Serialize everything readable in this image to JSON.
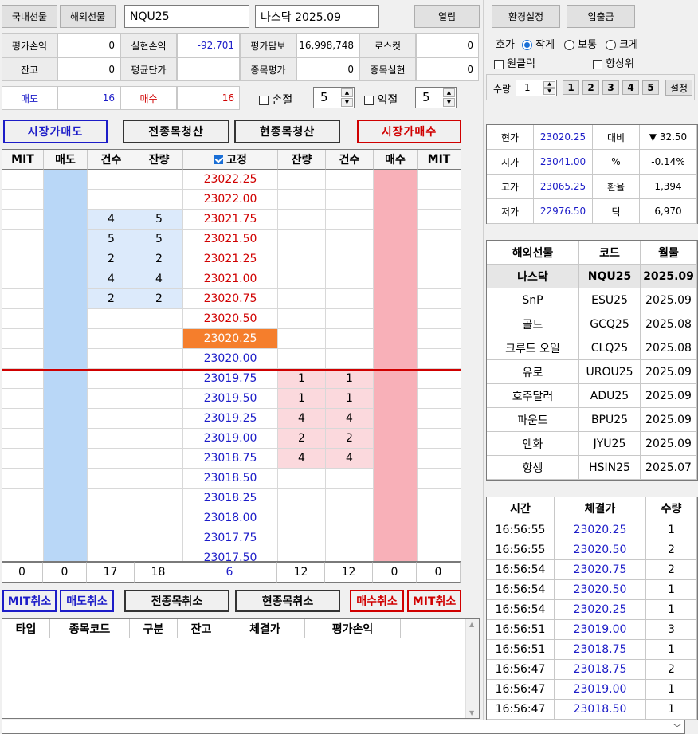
{
  "top": {
    "domestic_btn": "국내선물",
    "overseas_btn": "해외선물",
    "code": "NQU25",
    "name": "나스닥 2025.09",
    "open_btn": "열림",
    "settings_btn": "환경설정",
    "deposit_btn": "입출금"
  },
  "info": {
    "row1": [
      {
        "label": "평가손익",
        "value": "0"
      },
      {
        "label": "실현손익",
        "value": "-92,701"
      },
      {
        "label": "평가담보",
        "value": "16,998,748"
      },
      {
        "label": "로스컷",
        "value": "0"
      }
    ],
    "row2": [
      {
        "label": "잔고",
        "value": "0"
      },
      {
        "label": "평균단가",
        "value": ""
      },
      {
        "label": "종목평가",
        "value": "0"
      },
      {
        "label": "종목실현",
        "value": "0"
      }
    ],
    "sell_label": "매도",
    "sell_value": "16",
    "buy_label": "매수",
    "buy_value": "16",
    "stoploss_label": "손절",
    "stoploss_value": "5",
    "takeprofit_label": "익절",
    "takeprofit_value": "5"
  },
  "actions": {
    "market_sell": "시장가매도",
    "close_all": "전종목청산",
    "close_current": "현종목청산",
    "market_buy": "시장가매수"
  },
  "orderbook": {
    "headers": [
      "MIT",
      "매도",
      "건수",
      "잔량",
      "고정",
      "잔량",
      "건수",
      "매수",
      "MIT"
    ],
    "rows": [
      {
        "price": "23022.25",
        "sc": "",
        "sq": "",
        "bq": "",
        "bc": "",
        "side": "ask"
      },
      {
        "price": "23022.00",
        "sc": "",
        "sq": "",
        "bq": "",
        "bc": "",
        "side": "ask"
      },
      {
        "price": "23021.75",
        "sc": "4",
        "sq": "5",
        "bq": "",
        "bc": "",
        "side": "ask"
      },
      {
        "price": "23021.50",
        "sc": "5",
        "sq": "5",
        "bq": "",
        "bc": "",
        "side": "ask"
      },
      {
        "price": "23021.25",
        "sc": "2",
        "sq": "2",
        "bq": "",
        "bc": "",
        "side": "ask"
      },
      {
        "price": "23021.00",
        "sc": "4",
        "sq": "4",
        "bq": "",
        "bc": "",
        "side": "ask"
      },
      {
        "price": "23020.75",
        "sc": "2",
        "sq": "2",
        "bq": "",
        "bc": "",
        "side": "ask"
      },
      {
        "price": "23020.50",
        "sc": "",
        "sq": "",
        "bq": "",
        "bc": "",
        "side": "ask"
      },
      {
        "price": "23020.25",
        "sc": "",
        "sq": "",
        "bq": "",
        "bc": "",
        "side": "current"
      },
      {
        "price": "23020.00",
        "sc": "",
        "sq": "",
        "bq": "",
        "bc": "",
        "side": "bid"
      },
      {
        "price": "23019.75",
        "sc": "",
        "sq": "",
        "bq": "1",
        "bc": "1",
        "side": "bid"
      },
      {
        "price": "23019.50",
        "sc": "",
        "sq": "",
        "bq": "1",
        "bc": "1",
        "side": "bid"
      },
      {
        "price": "23019.25",
        "sc": "",
        "sq": "",
        "bq": "4",
        "bc": "4",
        "side": "bid"
      },
      {
        "price": "23019.00",
        "sc": "",
        "sq": "",
        "bq": "2",
        "bc": "2",
        "side": "bid"
      },
      {
        "price": "23018.75",
        "sc": "",
        "sq": "",
        "bq": "4",
        "bc": "4",
        "side": "bid"
      },
      {
        "price": "23018.50",
        "sc": "",
        "sq": "",
        "bq": "",
        "bc": "",
        "side": "bid"
      },
      {
        "price": "23018.25",
        "sc": "",
        "sq": "",
        "bq": "",
        "bc": "",
        "side": "bid"
      },
      {
        "price": "23018.00",
        "sc": "",
        "sq": "",
        "bq": "",
        "bc": "",
        "side": "bid"
      },
      {
        "price": "23017.75",
        "sc": "",
        "sq": "",
        "bq": "",
        "bc": "",
        "side": "bid"
      },
      {
        "price": "23017.50",
        "sc": "",
        "sq": "",
        "bq": "",
        "bc": "",
        "side": "bid"
      }
    ],
    "totals": [
      "0",
      "0",
      "17",
      "18",
      "6",
      "12",
      "12",
      "0",
      "0"
    ]
  },
  "cancel": {
    "mit_cancel_left": "MIT취소",
    "sell_cancel": "매도취소",
    "cancel_all": "전종목취소",
    "cancel_current": "현종목취소",
    "buy_cancel": "매수취소",
    "mit_cancel_right": "MIT취소"
  },
  "positions": {
    "headers": [
      "타입",
      "종목코드",
      "구분",
      "잔고",
      "체결가",
      "평가손익"
    ]
  },
  "settings": {
    "hoga_label": "호가",
    "size_small": "작게",
    "size_normal": "보통",
    "size_large": "크게",
    "oneclick": "원클릭",
    "always_top": "항상위",
    "qty_label": "수량",
    "qty_value": "1",
    "qty_presets": [
      "1",
      "2",
      "3",
      "4",
      "5"
    ],
    "set_btn": "설정"
  },
  "quote": {
    "rows": [
      {
        "l1": "현가",
        "v1": "23020.25",
        "l2": "대비",
        "v2": "▼ 32.50"
      },
      {
        "l1": "시가",
        "v1": "23041.00",
        "l2": "%",
        "v2": "-0.14%"
      },
      {
        "l1": "고가",
        "v1": "23065.25",
        "l2": "환율",
        "v2": "1,394"
      },
      {
        "l1": "저가",
        "v1": "22976.50",
        "l2": "틱",
        "v2": "6,970"
      }
    ]
  },
  "futures": {
    "headers": [
      "해외선물",
      "코드",
      "월물"
    ],
    "rows": [
      {
        "name": "나스닥",
        "code": "NQU25",
        "month": "2025.09",
        "selected": true
      },
      {
        "name": "SnP",
        "code": "ESU25",
        "month": "2025.09",
        "selected": false
      },
      {
        "name": "골드",
        "code": "GCQ25",
        "month": "2025.08",
        "selected": false
      },
      {
        "name": "크루드 오일",
        "code": "CLQ25",
        "month": "2025.08",
        "selected": false
      },
      {
        "name": "유로",
        "code": "UROU25",
        "month": "2025.09",
        "selected": false
      },
      {
        "name": "호주달러",
        "code": "ADU25",
        "month": "2025.09",
        "selected": false
      },
      {
        "name": "파운드",
        "code": "BPU25",
        "month": "2025.09",
        "selected": false
      },
      {
        "name": "엔화",
        "code": "JYU25",
        "month": "2025.09",
        "selected": false
      },
      {
        "name": "항셍",
        "code": "HSIN25",
        "month": "2025.07",
        "selected": false
      }
    ]
  },
  "trades": {
    "headers": [
      "시간",
      "체결가",
      "수량"
    ],
    "rows": [
      {
        "time": "16:56:55",
        "price": "23020.25",
        "qty": "1"
      },
      {
        "time": "16:56:55",
        "price": "23020.50",
        "qty": "2"
      },
      {
        "time": "16:56:54",
        "price": "23020.75",
        "qty": "2"
      },
      {
        "time": "16:56:54",
        "price": "23020.50",
        "qty": "1"
      },
      {
        "time": "16:56:54",
        "price": "23020.25",
        "qty": "1"
      },
      {
        "time": "16:56:51",
        "price": "23019.00",
        "qty": "3"
      },
      {
        "time": "16:56:51",
        "price": "23018.75",
        "qty": "1"
      },
      {
        "time": "16:56:47",
        "price": "23018.75",
        "qty": "2"
      },
      {
        "time": "16:56:47",
        "price": "23019.00",
        "qty": "1"
      },
      {
        "time": "16:56:47",
        "price": "23018.50",
        "qty": "1"
      }
    ]
  },
  "colors": {
    "ask_price": "#d00000",
    "bid_price": "#1c1cc8",
    "sell_col": "#b9d7f7",
    "buy_col": "#f8b0b8",
    "sell_qty_bg": "#dceafb",
    "buy_qty_bg": "#fbd9dd",
    "current_bg": "#f57e2c",
    "down": "#1c1cc8",
    "up": "#d00000"
  },
  "statusbar": {
    "value": ""
  }
}
